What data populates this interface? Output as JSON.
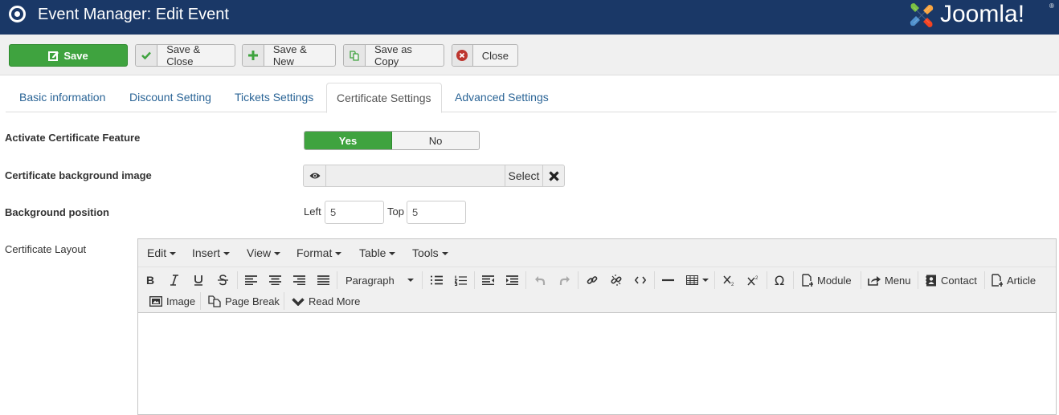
{
  "header": {
    "title": "Event Manager: Edit Event",
    "logo_text": "Joomla!",
    "logo_reg": "®",
    "colors": {
      "bar": "#1a3867"
    }
  },
  "toolbar": {
    "save": "Save",
    "save_close": "Save & Close",
    "save_new": "Save & New",
    "save_copy": "Save as Copy",
    "close": "Close",
    "colors": {
      "primary": "#3fa33f",
      "check": "#3fa33f",
      "close": "#bd362f"
    }
  },
  "tabs": [
    {
      "label": "Basic information",
      "active": false
    },
    {
      "label": "Discount Setting",
      "active": false
    },
    {
      "label": "Tickets Settings",
      "active": false
    },
    {
      "label": "Certificate Settings",
      "active": true
    },
    {
      "label": "Advanced Settings",
      "active": false
    }
  ],
  "form": {
    "activate": {
      "label": "Activate Certificate Feature",
      "yes": "Yes",
      "no": "No",
      "value": "Yes"
    },
    "bg_image": {
      "label": "Certificate background image",
      "value": "",
      "select": "Select"
    },
    "bg_position": {
      "label": "Background position",
      "left_label": "Left",
      "left_value": "5",
      "top_label": "Top",
      "top_value": "5"
    },
    "layout": {
      "label": "Certificate Layout"
    }
  },
  "editor": {
    "menus": [
      "Edit",
      "Insert",
      "View",
      "Format",
      "Table",
      "Tools"
    ],
    "block_format": "Paragraph",
    "buttons": {
      "module": "Module",
      "menu": "Menu",
      "contact": "Contact",
      "article": "Article",
      "image": "Image",
      "page_break": "Page Break",
      "read_more": "Read More"
    },
    "content": ""
  }
}
